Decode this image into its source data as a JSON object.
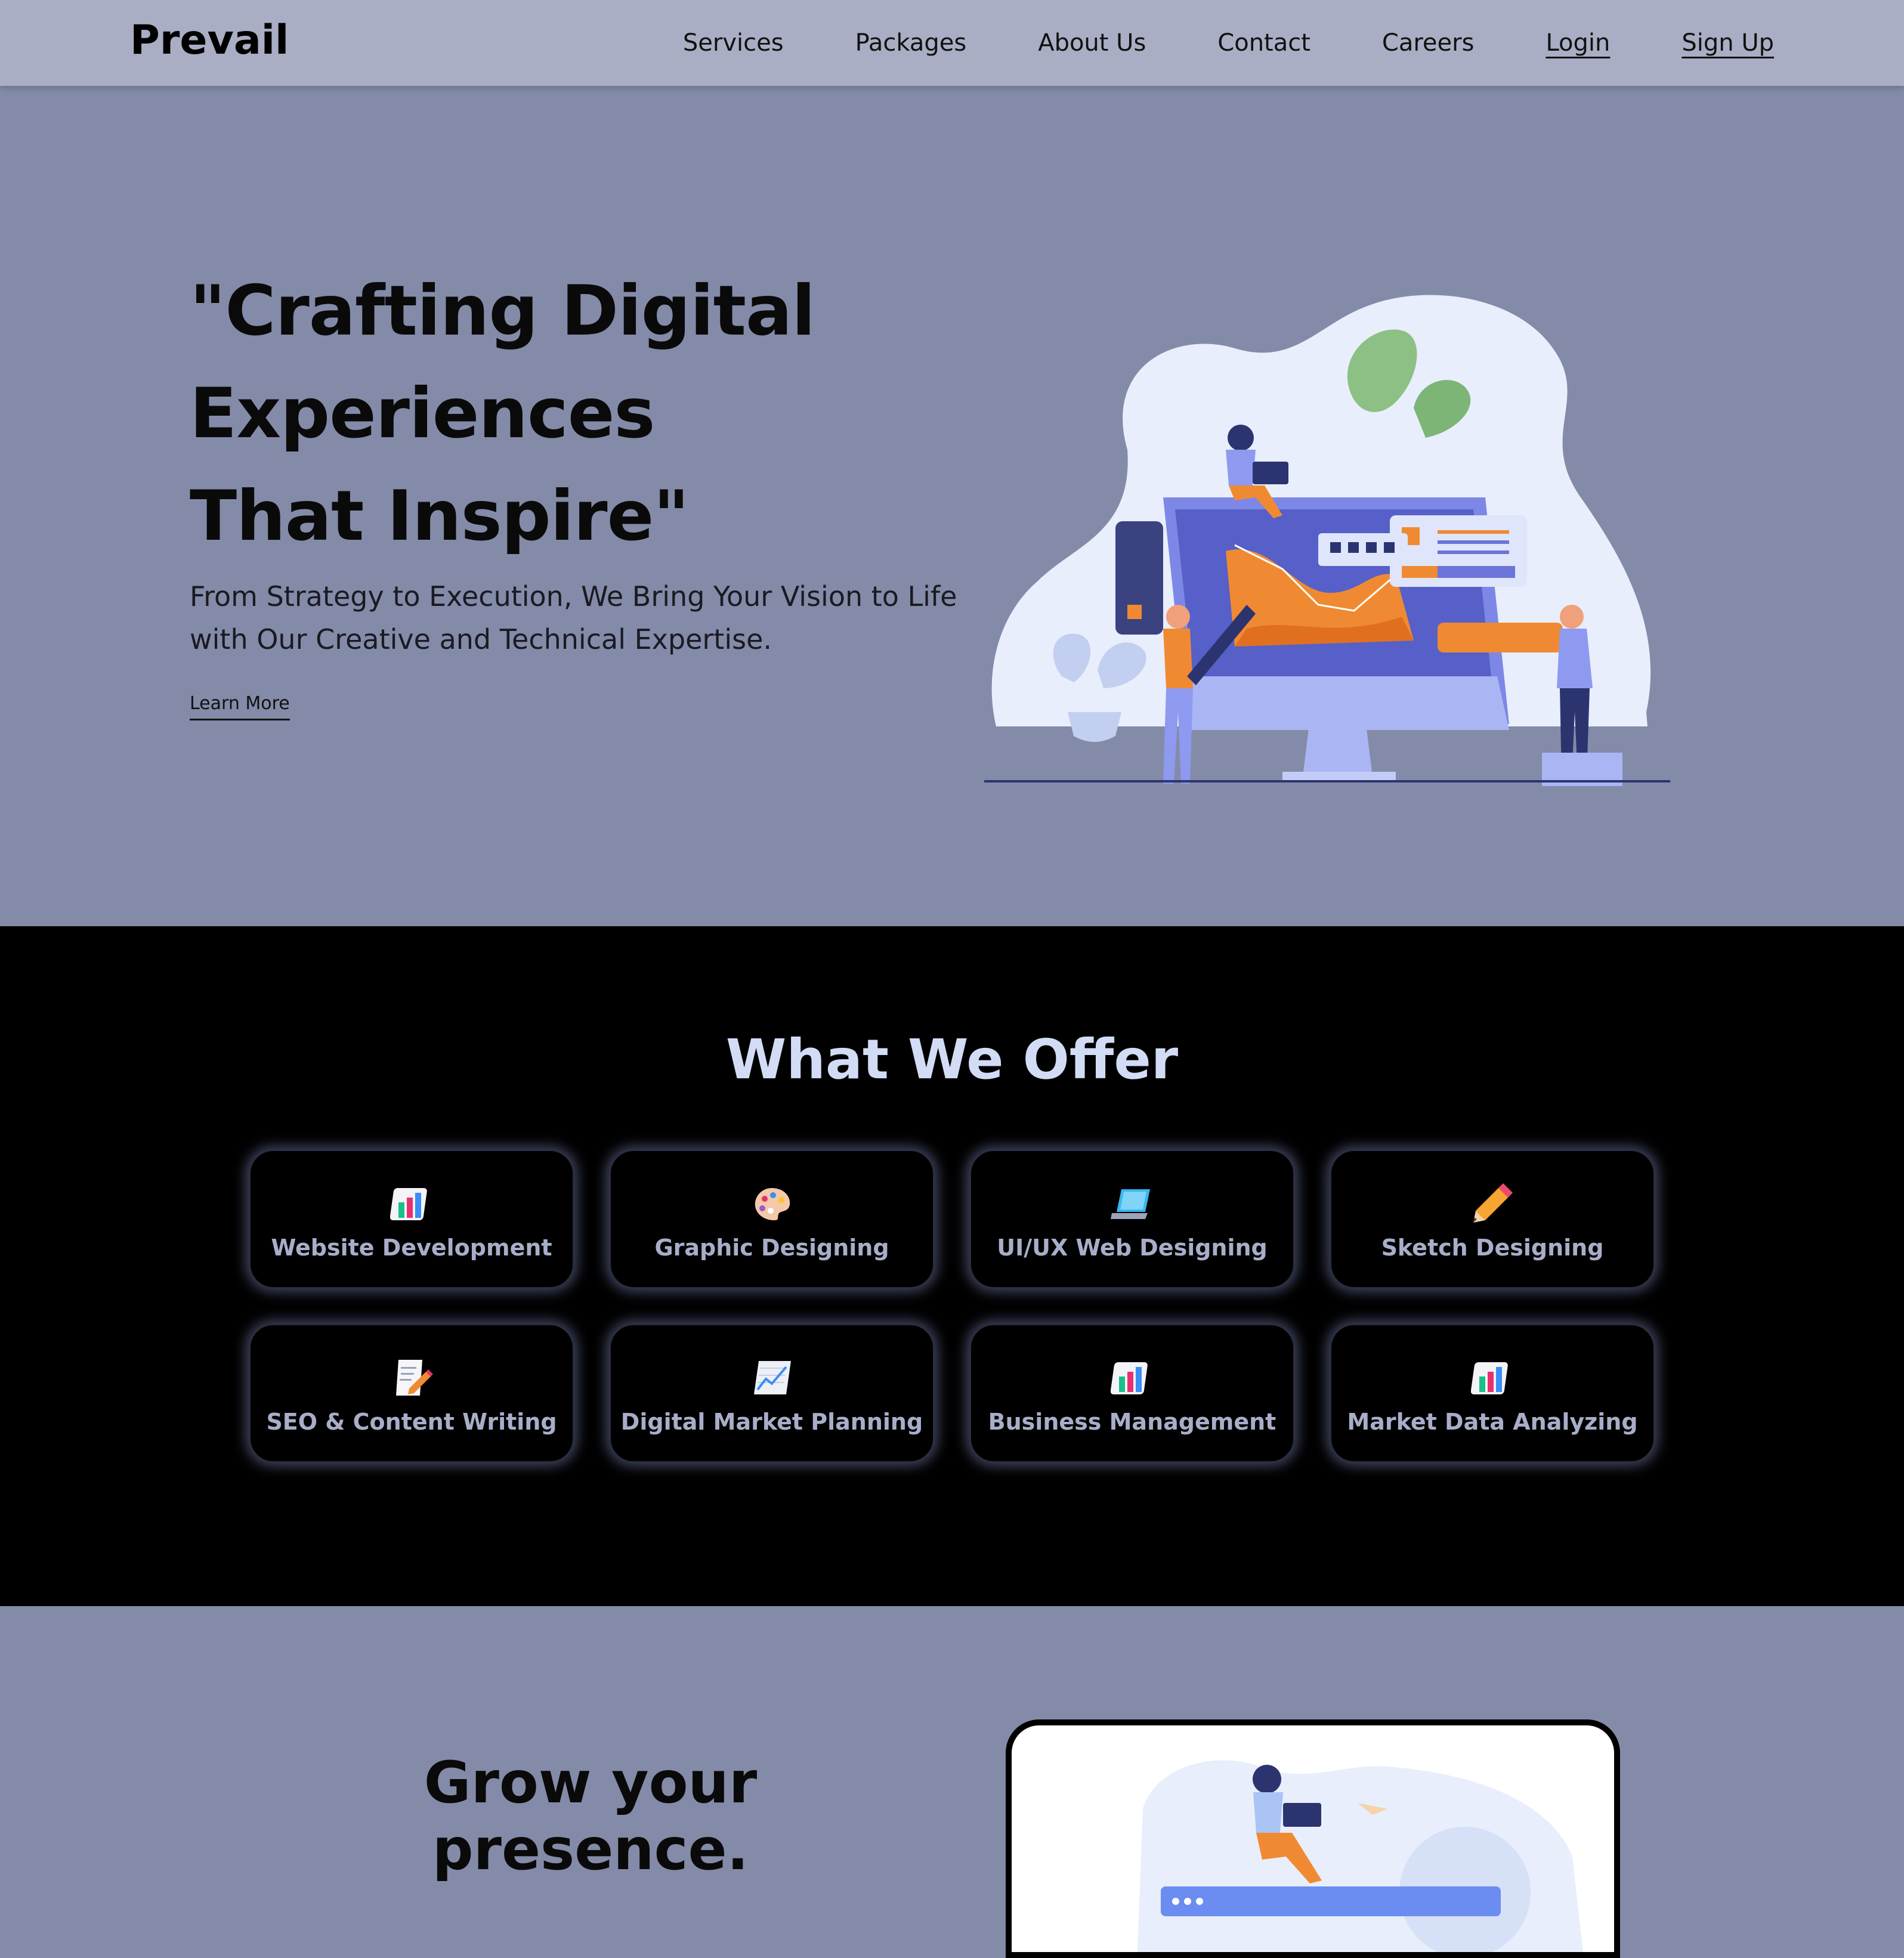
{
  "brand": {
    "name": "Prevail"
  },
  "nav": {
    "items": [
      {
        "label": "Services"
      },
      {
        "label": "Packages"
      },
      {
        "label": "About Us"
      },
      {
        "label": "Contact"
      },
      {
        "label": "Careers"
      },
      {
        "label": "Login"
      },
      {
        "label": "Sign Up"
      }
    ]
  },
  "hero": {
    "title": "\"Crafting Digital Experiences That Inspire\"",
    "subtitle": "From Strategy to Execution, We Bring Your Vision to Life with Our Creative and Technical Expertise.",
    "cta": "Learn More"
  },
  "offer": {
    "title": "What We Offer",
    "cards": [
      {
        "label": "Website Development",
        "icon": "bar-chart-icon"
      },
      {
        "label": "Graphic Designing",
        "icon": "palette-icon"
      },
      {
        "label": "UI/UX Web Designing",
        "icon": "laptop-icon"
      },
      {
        "label": "Sketch Designing",
        "icon": "pencil-icon"
      },
      {
        "label": "SEO & Content Writing",
        "icon": "memo-icon"
      },
      {
        "label": "Digital Market Planning",
        "icon": "line-chart-icon"
      },
      {
        "label": "Business Management",
        "icon": "bar-chart-icon"
      },
      {
        "label": "Market Data Analyzing",
        "icon": "bar-chart-icon"
      }
    ]
  },
  "grow": {
    "title": "Grow your presence."
  },
  "colors": {
    "nav_bg": "#a9aec4",
    "hero_bg": "#838ba8",
    "offer_bg": "#000000",
    "offer_title": "#d2dcf5",
    "card_text": "#a8aec9",
    "accent_orange": "#f08a32",
    "accent_blue": "#6b74d8"
  }
}
